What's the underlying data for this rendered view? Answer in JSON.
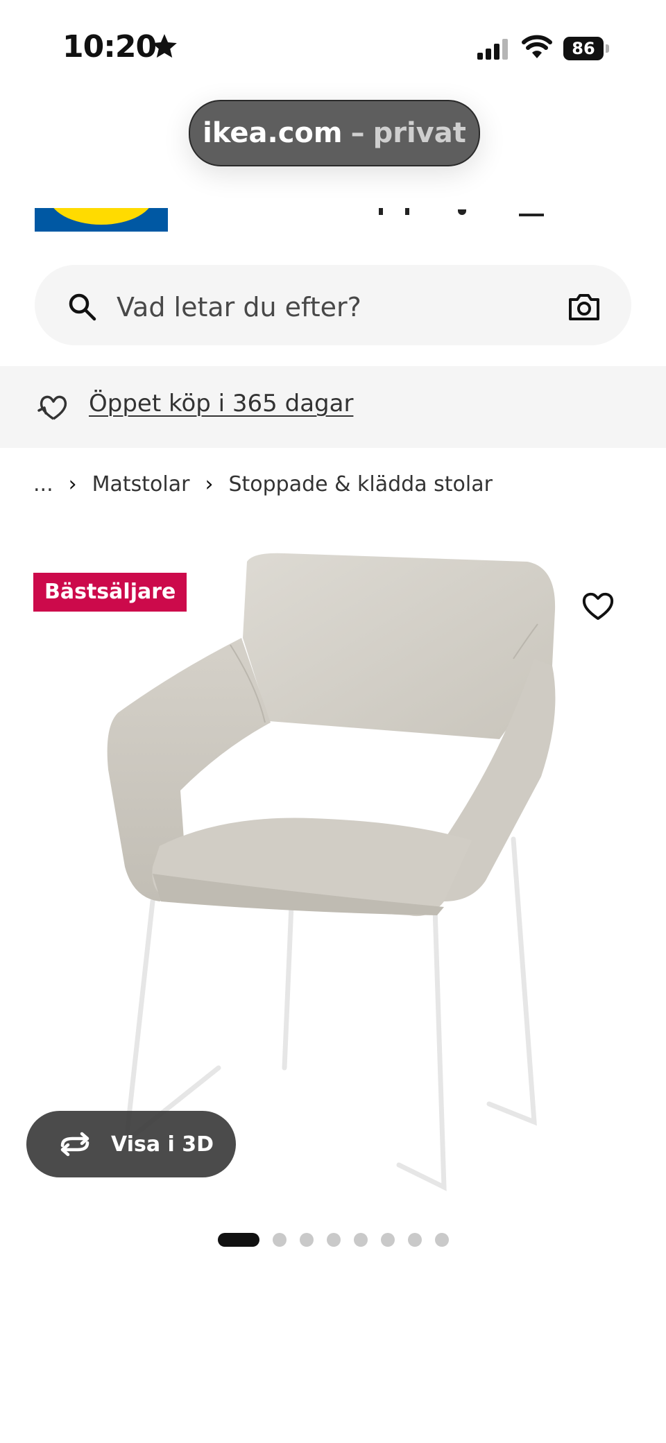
{
  "status_bar": {
    "time": "10:20",
    "battery": "86"
  },
  "browser": {
    "domain": "ikea.com",
    "separator": "–",
    "mode": "privat"
  },
  "search": {
    "placeholder": "Vad letar du efter?"
  },
  "promo": {
    "label": "Öppet köp i 365 dagar"
  },
  "breadcrumb": {
    "ellipsis": "...",
    "items": [
      "Matstolar",
      "Stoppade & klädda stolar"
    ]
  },
  "product": {
    "badge": "Bästsäljare",
    "view_3d_label": "Visa i 3D",
    "carousel": {
      "total": 8,
      "active_index": 0
    }
  },
  "colors": {
    "badge": "#cc0a4b",
    "ikea_blue": "#0058a3",
    "ikea_yellow": "#ffdb00"
  },
  "icons": [
    "star-icon",
    "signal-icon",
    "wifi-icon",
    "search-icon",
    "camera-icon",
    "returns-icon",
    "chevron-right-icon",
    "heart-icon",
    "rotate-3d-icon"
  ]
}
